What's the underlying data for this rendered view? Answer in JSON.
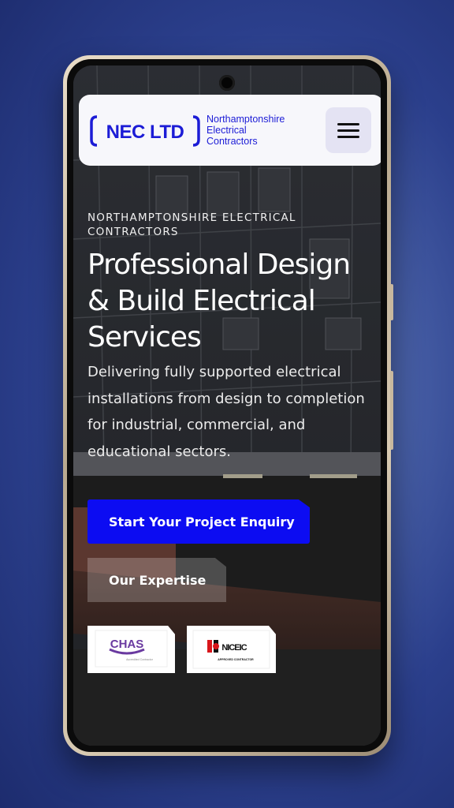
{
  "nav": {
    "logo_text": "NEC LTD",
    "tagline": [
      "Northamptonshire",
      "Electrical",
      "Contractors"
    ],
    "menu_icon": "hamburger-menu-icon"
  },
  "hero": {
    "eyebrow": "NORTHAMPTONSHIRE ELECTRICAL CONTRACTORS",
    "headline": "Professional Design & Build Electrical Services",
    "description": "Delivering fully supported electrical installations from design to completion for industrial, commercial, and educational sectors.",
    "primary_cta": "Start Your Project Enquiry",
    "secondary_cta": "Our Expertise"
  },
  "accreditations": {
    "chas": {
      "name": "CHAS",
      "subtitle": "Accredited Contractor"
    },
    "niceic": {
      "name": "NICEIC",
      "subtitle": "APPROVED CONTRACTOR"
    }
  },
  "colors": {
    "brand_blue": "#1c1cd6",
    "cta_blue": "#0c0cf2",
    "chas_purple": "#6a3aa0",
    "niceic_red": "#d8161b"
  }
}
